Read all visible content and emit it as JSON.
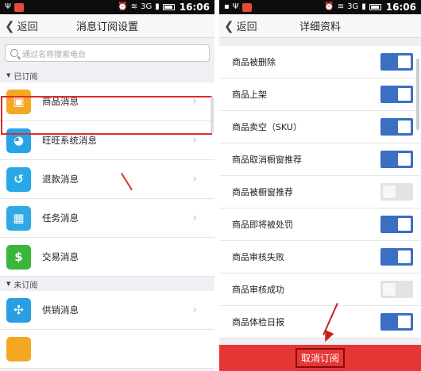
{
  "status_bar": {
    "time": "16:06",
    "network": "3G"
  },
  "left": {
    "nav": {
      "back_label": "返回",
      "title": "消息订阅设置"
    },
    "search": {
      "placeholder": "通过名称搜索电台"
    },
    "subscribed_header": "已订阅",
    "unsubscribed_header": "未订阅",
    "subscribed_items": [
      {
        "label": "商品消息",
        "icon": "package-icon",
        "color": "#f5a623"
      },
      {
        "label": "旺旺系统消息",
        "icon": "wangwang-icon",
        "color": "#25a5e8"
      },
      {
        "label": "退款消息",
        "icon": "refund-icon",
        "color": "#28a9e6"
      },
      {
        "label": "任务消息",
        "icon": "task-calendar-icon",
        "color": "#2fa8e5"
      },
      {
        "label": "交易消息",
        "icon": "trade-dollar-icon",
        "color": "#3bb53b"
      }
    ],
    "unsubscribed_items": [
      {
        "label": "供销消息",
        "icon": "supply-icon",
        "color": "#2a9ee2"
      }
    ],
    "colors": {
      "highlight": "#d9302c"
    }
  },
  "right": {
    "nav": {
      "back_label": "返回",
      "title": "详细资料"
    },
    "settings": [
      {
        "label": "商品被删除",
        "on": true
      },
      {
        "label": "商品上架",
        "on": true
      },
      {
        "label": "商品卖空（SKU）",
        "on": true
      },
      {
        "label": "商品取消橱窗推荐",
        "on": true
      },
      {
        "label": "商品被橱窗推荐",
        "on": false
      },
      {
        "label": "商品即将被处罚",
        "on": true
      },
      {
        "label": "商品审核失败",
        "on": true
      },
      {
        "label": "商品审核成功",
        "on": false
      },
      {
        "label": "商品体检日报",
        "on": true
      }
    ],
    "cancel_label": "取消订阅",
    "colors": {
      "toggle_on": "#3a6fc4",
      "bottom_bar": "#e53535"
    }
  }
}
